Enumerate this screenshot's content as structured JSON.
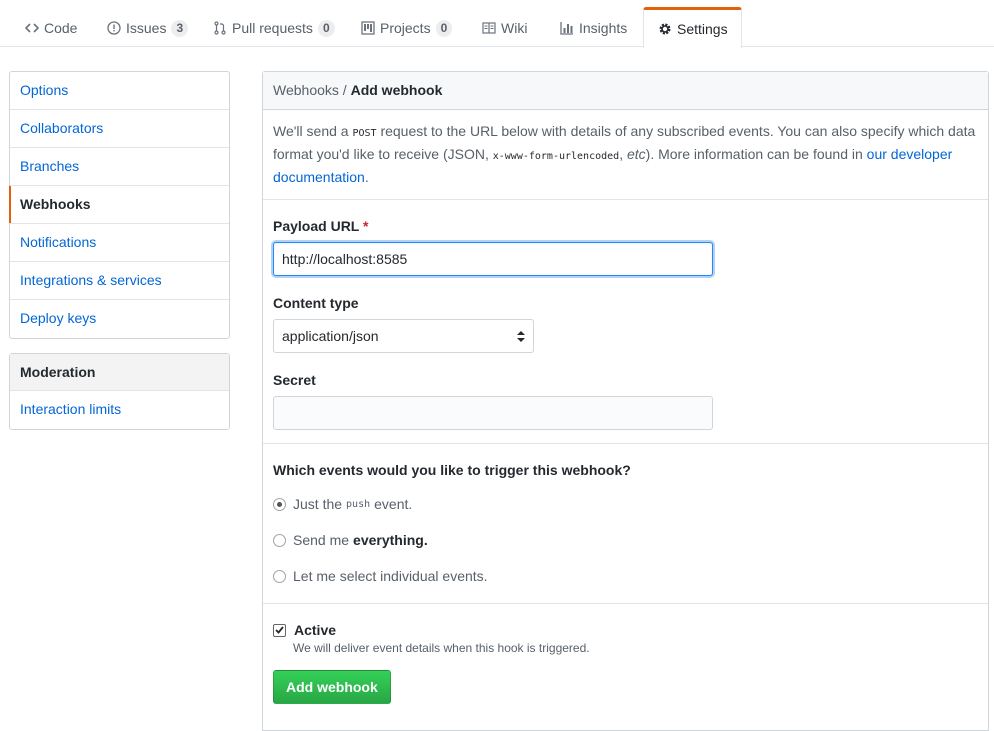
{
  "nav": {
    "code": "Code",
    "issues": "Issues",
    "issues_count": "3",
    "pulls": "Pull requests",
    "pulls_count": "0",
    "projects": "Projects",
    "projects_count": "0",
    "wiki": "Wiki",
    "insights": "Insights",
    "settings": "Settings"
  },
  "sidebar": {
    "items": [
      "Options",
      "Collaborators",
      "Branches",
      "Webhooks",
      "Notifications",
      "Integrations & services",
      "Deploy keys"
    ],
    "moderation_heading": "Moderation",
    "moderation_items": [
      "Interaction limits"
    ]
  },
  "main": {
    "breadcrumb_parent": "Webhooks",
    "breadcrumb_sep": " / ",
    "breadcrumb_current": "Add webhook",
    "intro": {
      "p1": "We'll send a ",
      "post": "POST",
      "p2": " request to the URL below with details of any subscribed events. You can also specify which data format you'd like to receive (JSON, ",
      "encoded": "x-www-form-urlencoded",
      "p3": ", ",
      "etc": "etc",
      "p4": "). More information can be found in ",
      "link": "our developer documentation",
      "p5": "."
    },
    "payload_label": "Payload URL",
    "required_mark": "*",
    "payload_value": "http://localhost:8585",
    "content_type_label": "Content type",
    "content_type_value": "application/json",
    "secret_label": "Secret",
    "secret_value": "",
    "events_question": "Which events would you like to trigger this webhook?",
    "event_push_a": "Just the",
    "event_push_code": "push",
    "event_push_b": "event.",
    "event_all_a": "Send me",
    "event_all_b": "everything.",
    "event_select": "Let me select individual events.",
    "active_label": "Active",
    "active_note": "We will deliver event details when this hook is triggered.",
    "submit_label": "Add webhook"
  },
  "colors": {
    "accent": "#e36209",
    "link": "#0366d6",
    "primary_button": "#28a745",
    "focus_border": "#2188ff"
  }
}
